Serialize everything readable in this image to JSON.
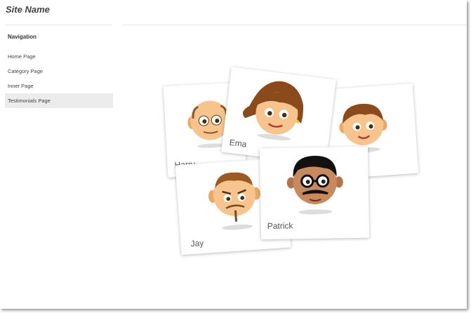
{
  "site": {
    "name": "Site Name"
  },
  "sidebar": {
    "title": "Navigation",
    "items": [
      {
        "label": "Home Page"
      },
      {
        "label": "Category Page"
      },
      {
        "label": "Inner Page"
      },
      {
        "label": "Testimonials Page",
        "active": true
      }
    ]
  },
  "testimonials": [
    {
      "name": "Harry"
    },
    {
      "name": "Ema"
    },
    {
      "name": ""
    },
    {
      "name": "Jay"
    },
    {
      "name": "Patrick"
    }
  ],
  "colors": {
    "skin": "#f6c48c",
    "skin_dark": "#e19b55",
    "hair_brown": "#8a4a1c",
    "patrick_skin": "#c88a5c",
    "active_bg": "#ececec"
  }
}
